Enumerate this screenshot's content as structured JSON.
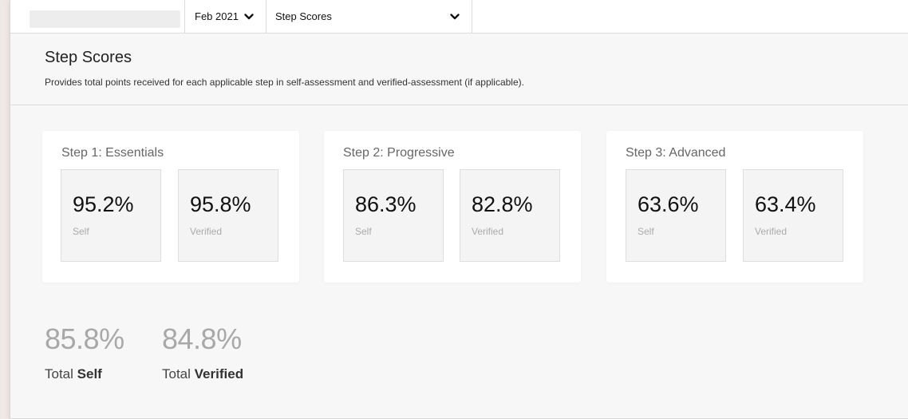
{
  "toolbar": {
    "period_label": "Feb 2021",
    "report_label": "Step Scores"
  },
  "header": {
    "title": "Step Scores",
    "description": "Provides total points received for each applicable step in self-assessment and verified-assessment (if applicable)."
  },
  "steps": [
    {
      "title": "Step 1: Essentials",
      "self_value": "95.2%",
      "self_label": "Self",
      "verified_value": "95.8%",
      "verified_label": "Verified"
    },
    {
      "title": "Step 2: Progressive",
      "self_value": "86.3%",
      "self_label": "Self",
      "verified_value": "82.8%",
      "verified_label": "Verified"
    },
    {
      "title": "Step 3: Advanced",
      "self_value": "63.6%",
      "self_label": "Self",
      "verified_value": "63.4%",
      "verified_label": "Verified"
    }
  ],
  "totals": {
    "self_value": "85.8%",
    "self_label_prefix": "Total",
    "self_label_strong": "Self",
    "verified_value": "84.8%",
    "verified_label_prefix": "Total",
    "verified_label_strong": "Verified"
  },
  "icons": {
    "dropdown": "chevron-down-icon"
  },
  "colors": {
    "page_background": "#f7f7f7",
    "card_background": "#ffffff",
    "score_box_background": "#f4f4f4",
    "total_value": "#a8a8a8"
  }
}
